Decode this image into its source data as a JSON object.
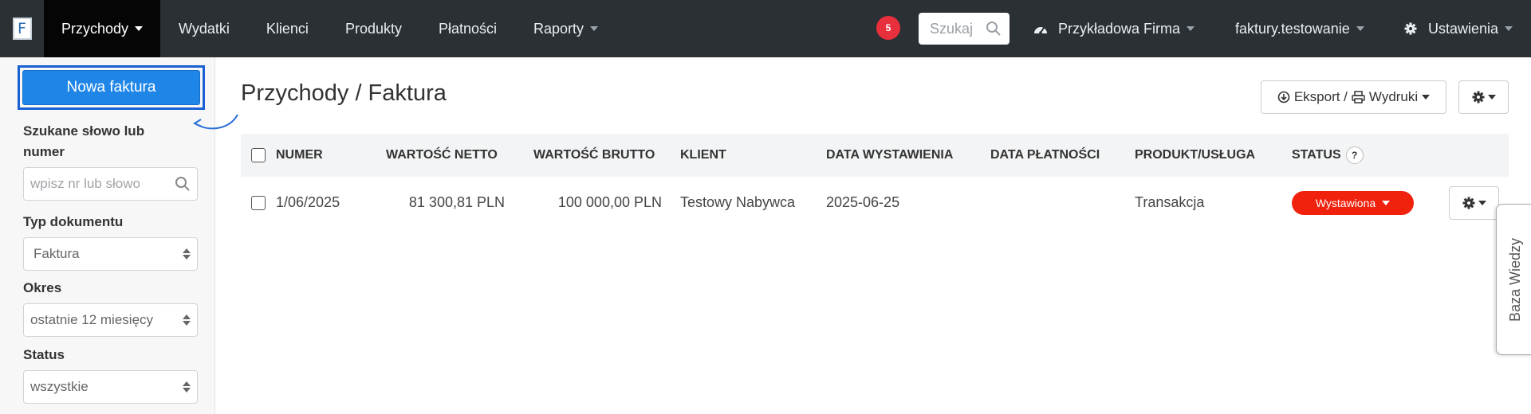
{
  "nav": {
    "logo": "F",
    "items": [
      {
        "label": "Przychody",
        "dropdown": true,
        "active": true
      },
      {
        "label": "Wydatki",
        "dropdown": false
      },
      {
        "label": "Klienci",
        "dropdown": false
      },
      {
        "label": "Produkty",
        "dropdown": false
      },
      {
        "label": "Płatności",
        "dropdown": false
      },
      {
        "label": "Raporty",
        "dropdown": true
      }
    ],
    "notification_count": "5",
    "search_placeholder": "Szukaj",
    "company": "Przykładowa Firma",
    "account": "faktury.testowanie",
    "settings": "Ustawienia"
  },
  "sidebar": {
    "new_invoice_label": "Nowa faktura",
    "search_label": "Szukane słowo lub numer",
    "search_placeholder": "wpisz nr lub słowo",
    "doc_type_label": "Typ dokumentu",
    "doc_type_value": "Faktura",
    "period_label": "Okres",
    "period_value": "ostatnie 12 miesięcy",
    "status_label": "Status",
    "status_value": "wszystkie"
  },
  "main": {
    "title": "Przychody / Faktura",
    "export_label": "Eksport / ",
    "print_label": "Wydruki",
    "table": {
      "headers": {
        "number": "NUMER",
        "net": "WARTOŚĆ NETTO",
        "gross": "WARTOŚĆ BRUTTO",
        "client": "KLIENT",
        "issue_date": "DATA WYSTAWIENIA",
        "payment_date": "DATA PŁATNOŚCI",
        "product": "PRODUKT/USŁUGA",
        "status": "STATUS",
        "status_help": "?"
      },
      "rows": [
        {
          "number": "1/06/2025",
          "net": "81 300,81 PLN",
          "gross": "100 000,00 PLN",
          "client": "Testowy Nabywca",
          "issue_date": "2025-06-25",
          "payment_date": "",
          "product": "Transakcja",
          "status": "Wystawiona"
        }
      ]
    }
  },
  "knowledge_base_tab": "Baza Wiedzy",
  "colors": {
    "nav_bg": "#2b3035",
    "primary_button": "#1f86e8",
    "status_issued": "#f0220e",
    "badge": "#e8303d"
  }
}
